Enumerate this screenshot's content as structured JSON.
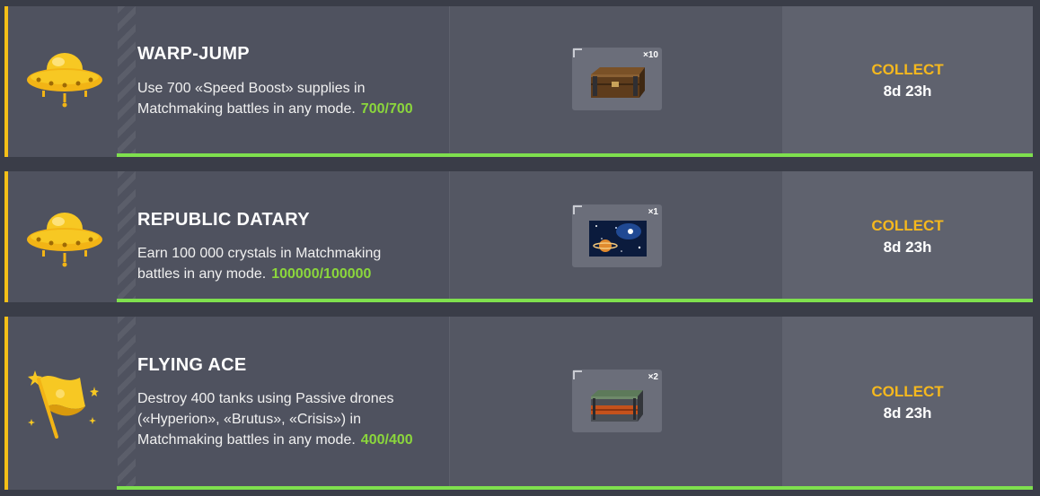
{
  "missions": [
    {
      "title": "WARP-JUMP",
      "description": "Use 700 «Speed Boost» supplies in Matchmaking battles in any mode.",
      "progress_text": "700/700",
      "progress_fraction": 1.0,
      "icon": "ufo-icon",
      "reward": {
        "item": "wooden-crate-icon",
        "quantity": "×10"
      },
      "action_label": "COLLECT",
      "time_left": "8d 23h"
    },
    {
      "title": "REPUBLIC DATARY",
      "description": "Earn 100 000 crystals in Matchmaking battles in any mode.",
      "progress_text": "100000/100000",
      "progress_fraction": 1.0,
      "icon": "ufo-icon",
      "reward": {
        "item": "space-paint-icon",
        "quantity": "×1"
      },
      "action_label": "COLLECT",
      "time_left": "8d 23h"
    },
    {
      "title": "FLYING ACE",
      "description": "Destroy 400 tanks using Passive drones («Hyperion», «Brutus», «Crisis») in Matchmaking battles in any mode.",
      "progress_text": "400/400",
      "progress_fraction": 1.0,
      "icon": "flag-icon",
      "reward": {
        "item": "metal-container-icon",
        "quantity": "×2"
      },
      "action_label": "COLLECT",
      "time_left": "8d 23h"
    }
  ],
  "colors": {
    "accent": "#f5c018",
    "progress_text": "#8bd63c",
    "progress_bar": "#7fe04e",
    "collect": "#f5b81e",
    "card_bg": "#4f525f"
  }
}
